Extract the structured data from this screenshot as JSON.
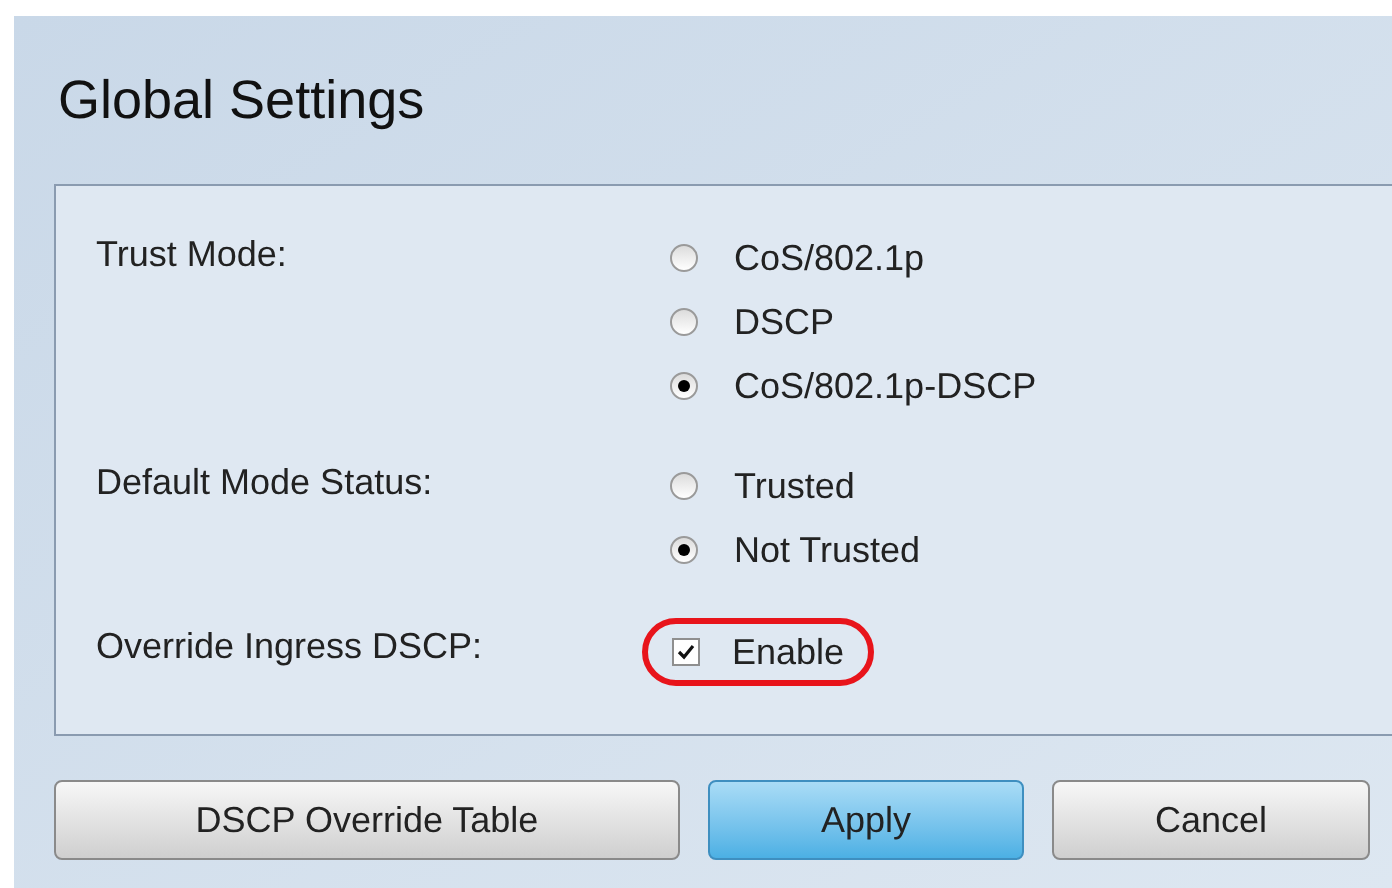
{
  "title": "Global Settings",
  "fields": [
    {
      "kind": "radio",
      "label": "Trust Mode:",
      "options": [
        {
          "label": "CoS/802.1p",
          "selected": false
        },
        {
          "label": "DSCP",
          "selected": false
        },
        {
          "label": "CoS/802.1p-DSCP",
          "selected": true
        }
      ]
    },
    {
      "kind": "radio",
      "label": "Default Mode Status:",
      "options": [
        {
          "label": "Trusted",
          "selected": false
        },
        {
          "label": "Not Trusted",
          "selected": true
        }
      ]
    },
    {
      "kind": "checkbox",
      "label": "Override Ingress DSCP:",
      "option": "Enable",
      "checked": true,
      "highlighted": true
    }
  ],
  "buttons": [
    {
      "label": "DSCP Override Table",
      "primary": false
    },
    {
      "label": "Apply",
      "primary": true
    },
    {
      "label": "Cancel",
      "primary": false
    }
  ]
}
